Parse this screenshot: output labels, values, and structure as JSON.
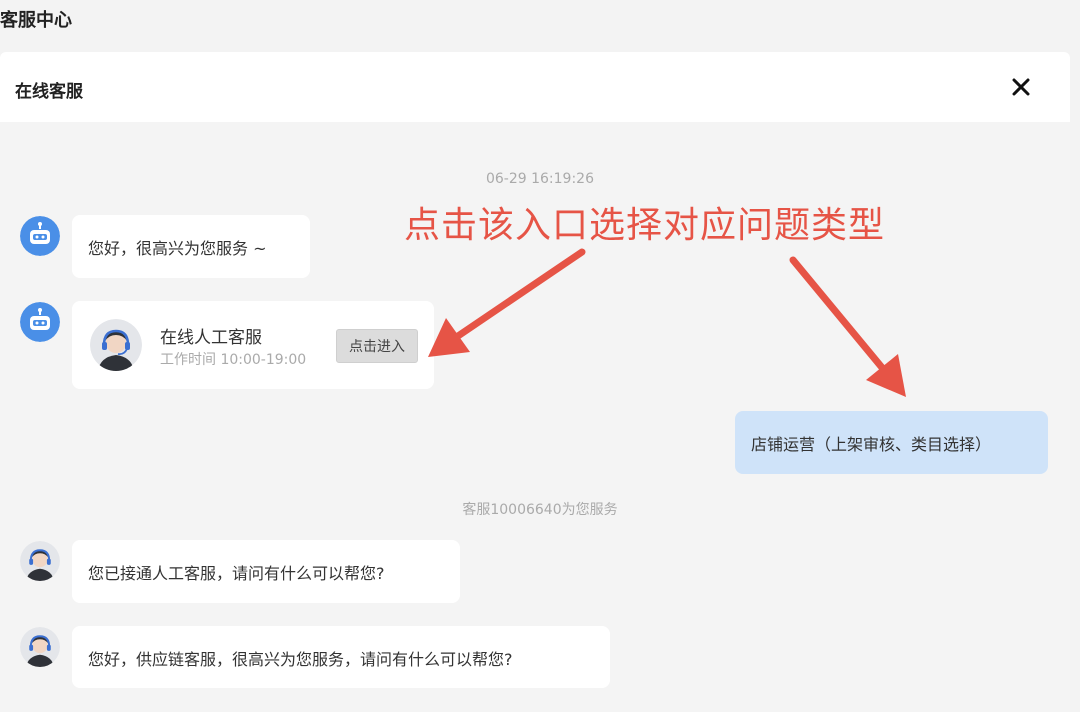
{
  "page": {
    "title": "客服中心"
  },
  "panel": {
    "title": "在线客服"
  },
  "chat": {
    "timestamp": "06-29 16:19:26",
    "bot_greeting": "您好，很高兴为您服务 ~",
    "card": {
      "name": "在线人工客服",
      "hours": "工作时间 10:00-19:00",
      "button_label": "点击进入"
    },
    "user_message": "店铺运营（上架审核、类目选择）",
    "system_notice": "客服10006640为您服务",
    "agent_message_1": "您已接通人工客服，请问有什么可以帮您?",
    "agent_message_2": "您好，供应链客服，很高兴为您服务，请问有什么可以帮您?"
  },
  "annotation": {
    "text": "点击该入口选择对应问题类型",
    "color": "#e65446"
  },
  "colors": {
    "bot_avatar": "#4a8fe7",
    "user_bubble": "#cfe3f9"
  }
}
